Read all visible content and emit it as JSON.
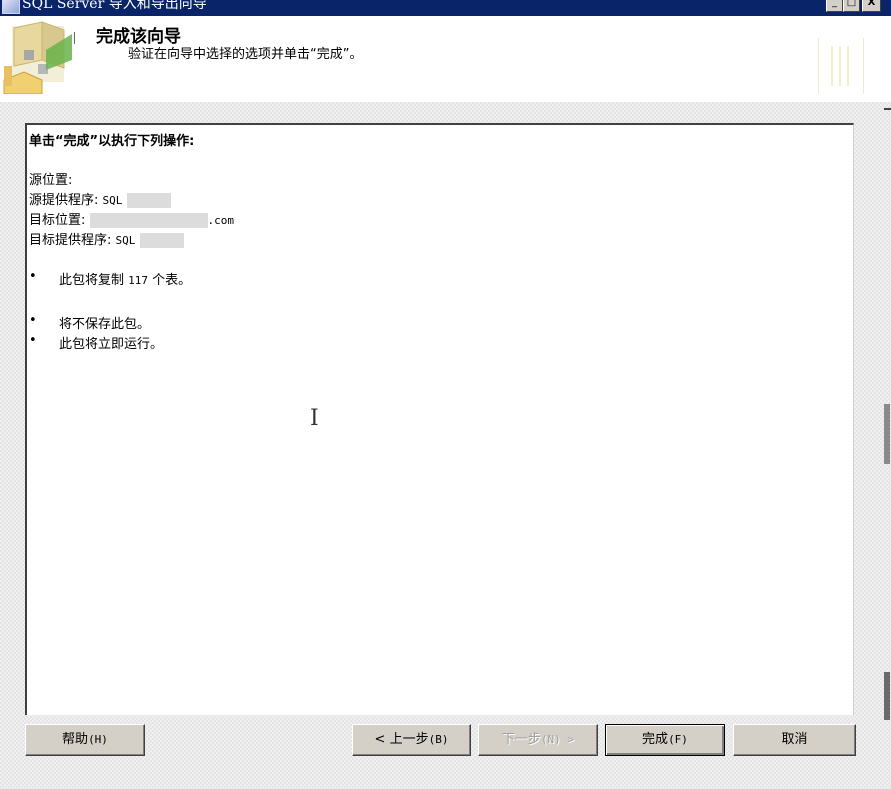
{
  "window": {
    "title": "SQL Server 导入和导出向导",
    "controls": {
      "minimize": "_",
      "maximize": "□",
      "close": "X"
    }
  },
  "header": {
    "title": "完成该向导",
    "subtitle": "验证在向导中选择的选项并单击“完成”。"
  },
  "summary": {
    "heading": "单击“完成”以执行下列操作:",
    "source_location_label": "源位置:",
    "source_provider_label": "源提供程序:",
    "source_provider_value": "SQL",
    "target_location_label": "目标位置:",
    "target_location_value": ".com",
    "target_provider_label": "目标提供程序:",
    "target_provider_value": "SQL",
    "bullets": [
      {
        "prefix": "此包将复制 ",
        "count": "117",
        "suffix": " 个表。"
      },
      {
        "text": "将不保存此包。"
      },
      {
        "text": "此包将立即运行。"
      }
    ],
    "bullet_char": "•"
  },
  "cursor_glyph": "I",
  "buttons": {
    "help": {
      "label": "帮助",
      "key": "(H)"
    },
    "back": {
      "label": "< 上一步",
      "key": "(B)"
    },
    "next": {
      "label": "下一步",
      "key": "(N) >"
    },
    "finish": {
      "label": "完成",
      "key": "(F)"
    },
    "cancel": {
      "label": "取消"
    }
  }
}
